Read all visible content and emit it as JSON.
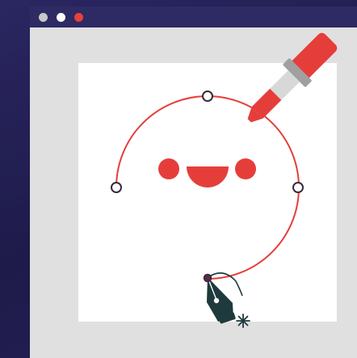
{
  "window": {
    "controls": [
      {
        "name": "window-control-1",
        "color": "#c8c8c8"
      },
      {
        "name": "window-control-2",
        "color": "#ffffff"
      },
      {
        "name": "window-control-3",
        "color": "#e8403a"
      }
    ]
  },
  "colors": {
    "accent": "#e53e3a",
    "title_bar": "#2e2a63",
    "background": "#1f1c4d",
    "canvas": "#ffffff",
    "pen": "#1e3a3c"
  },
  "icons": [
    "eyedropper-icon",
    "pen-tool-icon",
    "sparkle-icon",
    "smiley-face"
  ]
}
